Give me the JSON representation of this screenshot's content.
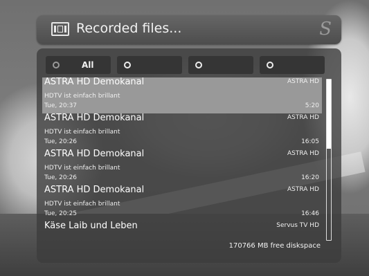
{
  "title": {
    "text": "Recorded files...",
    "icon": "film-icon",
    "logo_icon": "sky-logo-icon"
  },
  "filters": [
    {
      "label": "All",
      "selected": true
    },
    {
      "label": ""
    },
    {
      "label": ""
    },
    {
      "label": ""
    }
  ],
  "recordings": [
    {
      "name": "ASTRA HD Demokanal",
      "channel": "ASTRA HD",
      "description": "HDTV ist einfach brillant",
      "datetime": "Tue, 20:37",
      "duration": "5:20",
      "selected": true
    },
    {
      "name": "ASTRA HD Demokanal",
      "channel": "ASTRA HD",
      "description": "HDTV ist einfach brillant",
      "datetime": "Tue, 20:26",
      "duration": "16:05"
    },
    {
      "name": "ASTRA HD Demokanal",
      "channel": "ASTRA HD",
      "description": "HDTV ist einfach brillant",
      "datetime": "Tue, 20:26",
      "duration": "16:20"
    },
    {
      "name": "ASTRA HD Demokanal",
      "channel": "ASTRA HD",
      "description": "HDTV ist einfach brillant",
      "datetime": "Tue, 20:25",
      "duration": "16:46"
    },
    {
      "name": "Käse Laib und Leben",
      "channel": "Servus TV HD"
    }
  ],
  "diskspace": "170766 MB free diskspace",
  "colors": {
    "panel": "#3c3c3c",
    "selection": "#999999",
    "text": "#ffffff"
  }
}
